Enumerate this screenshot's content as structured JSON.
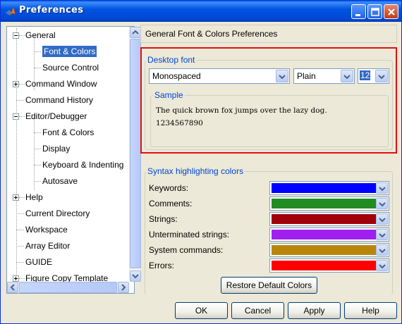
{
  "window": {
    "title": "Preferences",
    "icon": "matlab-logo-icon",
    "controls": [
      "minimize-icon",
      "maximize-icon",
      "close-icon"
    ]
  },
  "tree": {
    "items": [
      {
        "label": "General",
        "expander": "minus"
      },
      {
        "label": "Font & Colors",
        "selected": true
      },
      {
        "label": "Source Control"
      },
      {
        "label": "Command Window",
        "expander": "plus"
      },
      {
        "label": "Command History"
      },
      {
        "label": "Editor/Debugger",
        "expander": "minus"
      },
      {
        "label": "Font & Colors"
      },
      {
        "label": "Display"
      },
      {
        "label": "Keyboard & Indenting"
      },
      {
        "label": "Autosave"
      },
      {
        "label": "Help",
        "expander": "plus"
      },
      {
        "label": "Current Directory"
      },
      {
        "label": "Workspace"
      },
      {
        "label": "Array Editor"
      },
      {
        "label": "GUIDE"
      },
      {
        "label": "Figure Copy Template",
        "expander": "plus"
      }
    ]
  },
  "panel": {
    "header": "General Font & Colors Preferences",
    "desktop_font": {
      "title": "Desktop font",
      "family": "Monospaced",
      "style": "Plain",
      "size": "12",
      "sample_title": "Sample",
      "sample_line1": "The quick brown fox jumps over the lazy dog.",
      "sample_line2": "1234567890"
    },
    "syntax": {
      "title": "Syntax highlighting colors",
      "rows": [
        {
          "label": "Keywords:",
          "color": "#0000ff"
        },
        {
          "label": "Comments:",
          "color": "#228b22"
        },
        {
          "label": "Strings:",
          "color": "#a0000a"
        },
        {
          "label": "Unterminated strings:",
          "color": "#a020f0"
        },
        {
          "label": "System commands:",
          "color": "#b8860b"
        },
        {
          "label": "Errors:",
          "color": "#ff0000"
        }
      ]
    },
    "restore_label": "Restore Default Colors"
  },
  "footer": {
    "ok_label": "OK",
    "cancel_label": "Cancel",
    "apply_label": "Apply",
    "help_label": "Help"
  }
}
